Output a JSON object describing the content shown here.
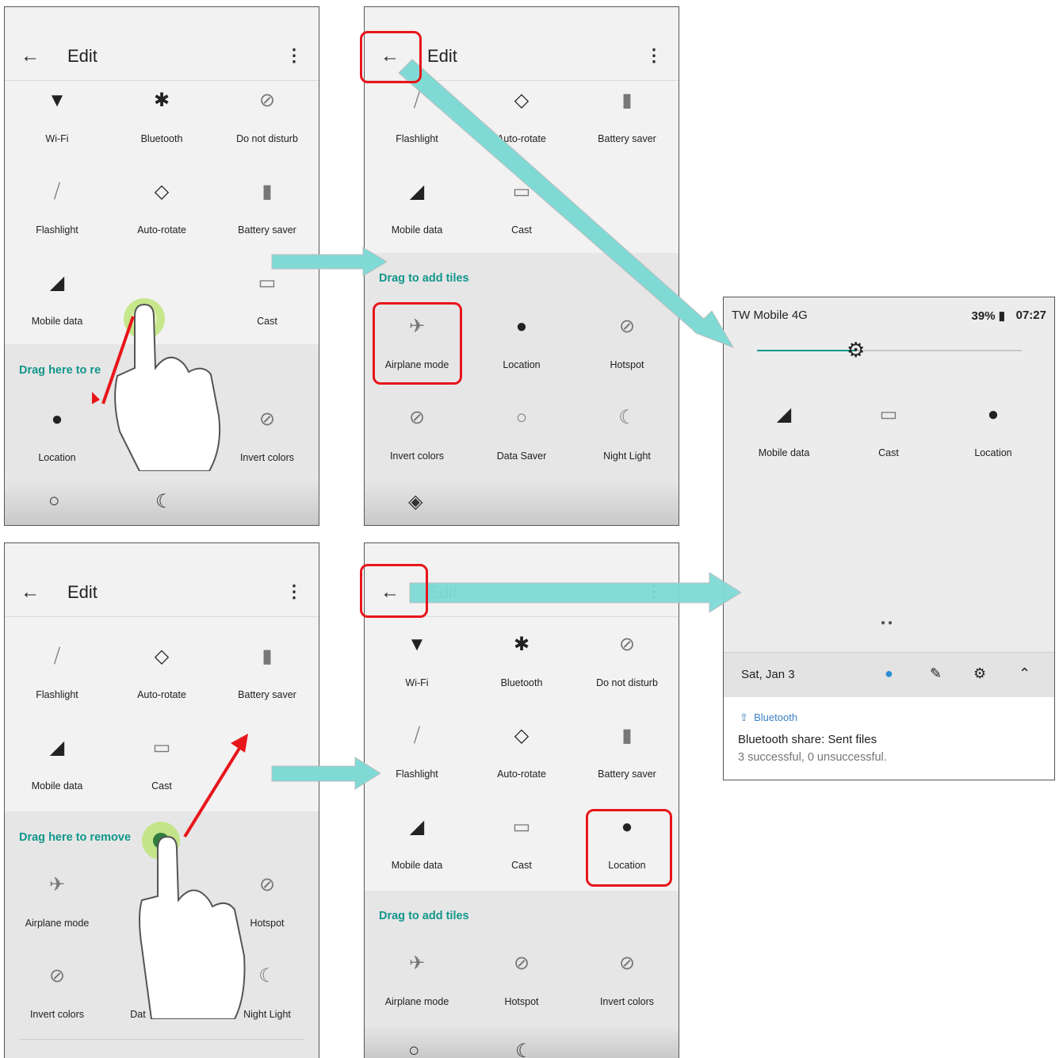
{
  "colors": {
    "accent": "#12968b",
    "highlight": "#e8151b",
    "arrow": "#7fdad6"
  },
  "screens": {
    "edit_title": "Edit",
    "p1": {
      "tiles": [
        "Wi-Fi",
        "Bluetooth",
        "Do not disturb",
        "Flashlight",
        "Auto-rotate",
        "Battery saver",
        "Mobile data",
        "Cast",
        "Location",
        "Invert colors"
      ],
      "drag_label": "Drag here to re"
    },
    "p2": {
      "tiles": [
        "Flashlight",
        "Auto-rotate",
        "Battery saver",
        "Mobile data",
        "Cast",
        "Airplane mode",
        "Location",
        "Hotspot",
        "Invert colors",
        "Data Saver",
        "Night Light"
      ],
      "drag_label": "Drag to add tiles"
    },
    "p3": {
      "tiles": [
        "Flashlight",
        "Auto-rotate",
        "Battery saver",
        "Mobile data",
        "Cast",
        "Airplane mode",
        "Hotspot",
        "Invert colors",
        "Dat",
        "Night Light"
      ],
      "drag_label": "Drag here to remove"
    },
    "p4": {
      "tiles": [
        "Wi-Fi",
        "Bluetooth",
        "Do not disturb",
        "Flashlight",
        "Auto-rotate",
        "Battery saver",
        "Mobile data",
        "Cast",
        "Location",
        "Airplane mode",
        "Hotspot",
        "Invert colors"
      ],
      "drag_label": "Drag to add tiles"
    }
  },
  "shade": {
    "carrier": "TW Mobile 4G",
    "battery": "39%",
    "time": "07:27",
    "tiles": [
      "Mobile data",
      "Cast",
      "Location"
    ],
    "date": "Sat, Jan 3",
    "notification": {
      "app": "Bluetooth",
      "title": "Bluetooth share: Sent files",
      "body": "3 successful, 0 unsuccessful."
    }
  }
}
